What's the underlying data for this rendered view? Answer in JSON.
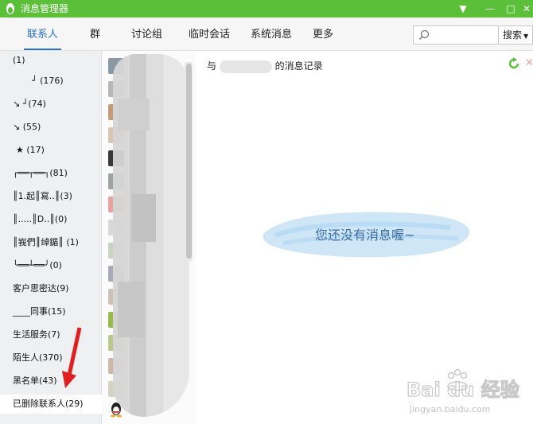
{
  "window": {
    "title": "消息管理器",
    "controls": [
      "▼",
      "—",
      "□",
      "✕"
    ]
  },
  "toolbar": {
    "tabs": [
      "联系人",
      "群",
      "讨论组",
      "临时会话",
      "系统消息",
      "更多"
    ],
    "search_placeholder": "",
    "search_button": "搜索"
  },
  "groups": [
    "(1)",
    "┘ (176)",
    "↘ ┘(74)",
    "↘ (55)",
    "★ (17)",
    "┌══┬══┐(81)",
    "║1.起║寫..║(3)",
    "║.....║D..║(0)",
    "║峩們║绰鍎║ (1)",
    "╰══┴══╯(0)",
    "客户思密达(9)",
    "____同事(15)",
    "生活服务(7)",
    "陌生人(370)",
    "黑名单(43)",
    "已删除联系人(29)"
  ],
  "selected_group": "已删除联系人(29)",
  "main": {
    "header_prefix": "与",
    "header_suffix": "的消息记录",
    "empty_message": "您还没有消息喔~"
  },
  "watermark": {
    "brand": "Bai du 经验",
    "url": "jingyan.baidu.com"
  },
  "colors": {
    "titlebar": "#5cbf3a",
    "accent": "#2a72c6",
    "arrow": "#e02020"
  }
}
